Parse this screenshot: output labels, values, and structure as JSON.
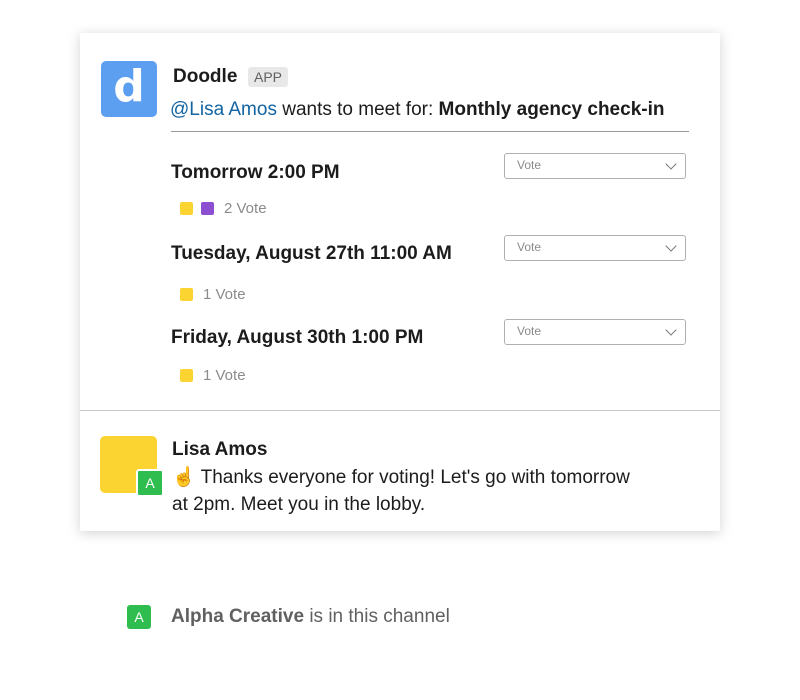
{
  "doodle_message": {
    "avatar_letter": "d",
    "app_name": "Doodle",
    "badge": "APP",
    "mention": "@Lisa Amos",
    "intro_text": " wants to meet for: ",
    "meeting_title": "Monthly agency check-in"
  },
  "options": [
    {
      "time": "Tomorrow 2:00 PM",
      "select_placeholder": "Vote",
      "vote_count": "2 Vote",
      "voter_colors": [
        "#fbd432",
        "#8c4fd1"
      ]
    },
    {
      "time": "Tuesday, August 27th 11:00 AM",
      "select_placeholder": "Vote",
      "vote_count": "1 Vote",
      "voter_colors": [
        "#fbd432"
      ]
    },
    {
      "time": "Friday, August 30th 1:00 PM",
      "select_placeholder": "Vote",
      "vote_count": "1 Vote",
      "voter_colors": [
        "#fbd432"
      ]
    }
  ],
  "reply": {
    "user_name": "Lisa Amos",
    "avatar_badge": "A",
    "emoji": "☝️",
    "text_line1": "Thanks everyone for voting! Let's go with tomorrow",
    "text_line2": "at 2pm. Meet you in the lobby."
  },
  "channel_notice": {
    "badge": "A",
    "org_name": "Alpha Creative",
    "text": " is in this channel"
  },
  "colors": {
    "brand_blue": "#5c9ff0",
    "mention_blue": "#1264a3",
    "yellow": "#fbd432",
    "purple": "#8c4fd1",
    "green": "#2ebd4e"
  }
}
